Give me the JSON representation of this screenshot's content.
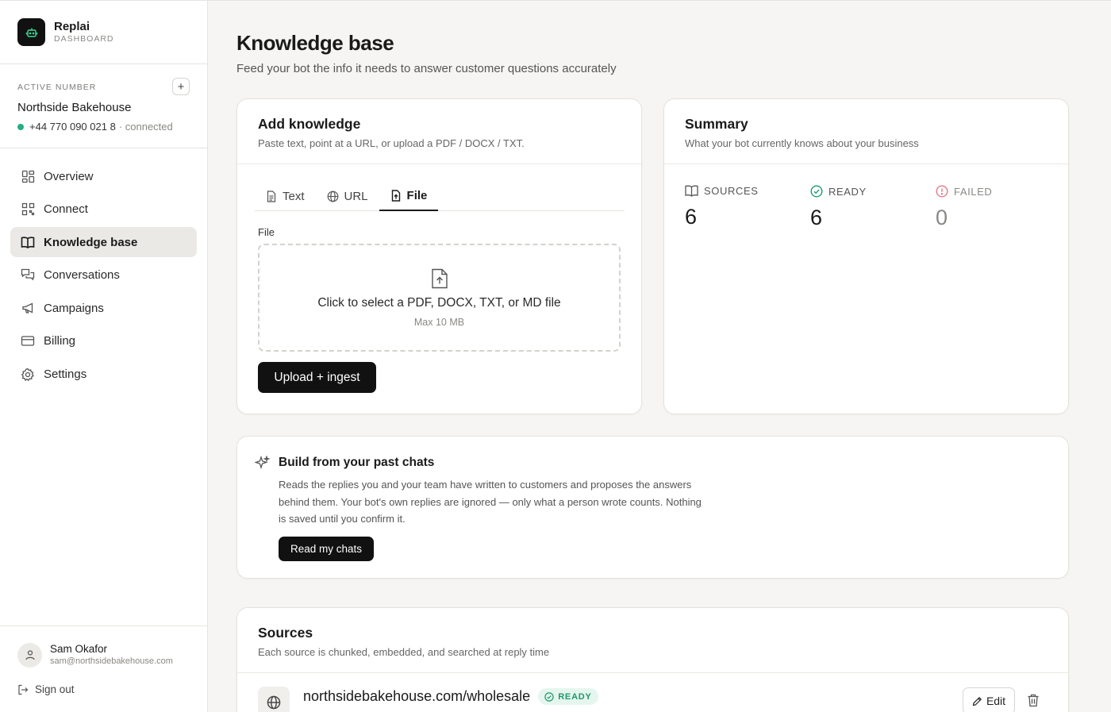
{
  "app": {
    "name": "Replai",
    "sub": "DASHBOARD"
  },
  "sidebar": {
    "active_label": "ACTIVE NUMBER",
    "add_number": "+",
    "business": "Northside Bakehouse",
    "phone": "+44 770 090 021 8",
    "phone_status": "· connected",
    "items": [
      {
        "label": "Overview",
        "icon": "grid-icon"
      },
      {
        "label": "Connect",
        "icon": "qr-icon"
      },
      {
        "label": "Knowledge base",
        "icon": "book-icon",
        "active": true
      },
      {
        "label": "Conversations",
        "icon": "chat-icon"
      },
      {
        "label": "Campaigns",
        "icon": "megaphone-icon"
      },
      {
        "label": "Billing",
        "icon": "card-icon"
      },
      {
        "label": "Settings",
        "icon": "gear-icon"
      }
    ],
    "user": {
      "name": "Sam Okafor",
      "email": "sam@northsidebakehouse.com"
    },
    "signout": "Sign out"
  },
  "page": {
    "title": "Knowledge base",
    "subtitle": "Feed your bot the info it needs to answer customer questions accurately"
  },
  "add_knowledge": {
    "title": "Add knowledge",
    "subtitle": "Paste text, point at a URL, or upload a PDF / DOCX / TXT.",
    "tabs": [
      {
        "label": "Text"
      },
      {
        "label": "URL"
      },
      {
        "label": "File",
        "active": true
      }
    ],
    "file_label": "File",
    "dropzone_text": "Click to select a PDF, DOCX, TXT, or MD file",
    "dropzone_max": "Max 10 MB",
    "upload_button": "Upload + ingest"
  },
  "summary": {
    "title": "Summary",
    "subtitle": "What your bot currently knows about your business",
    "stats": [
      {
        "label": "SOURCES",
        "value": "6"
      },
      {
        "label": "READY",
        "value": "6"
      },
      {
        "label": "FAILED",
        "value": "0"
      }
    ]
  },
  "build": {
    "title": "Build from your past chats",
    "description": "Reads the replies you and your team have written to customers and proposes the answers behind them. Your bot's own replies are ignored — only what a person wrote counts. Nothing is saved until you confirm it.",
    "button": "Read my chats"
  },
  "sources": {
    "title": "Sources",
    "subtitle": "Each source is chunked, embedded, and searched at reply time",
    "items": [
      {
        "name": "northsidebakehouse.com/wholesale",
        "status": "READY",
        "edit": "Edit"
      }
    ]
  },
  "colors": {
    "accent_green": "#22b07d",
    "failed_red": "#e07a8a",
    "dark": "#111111"
  }
}
